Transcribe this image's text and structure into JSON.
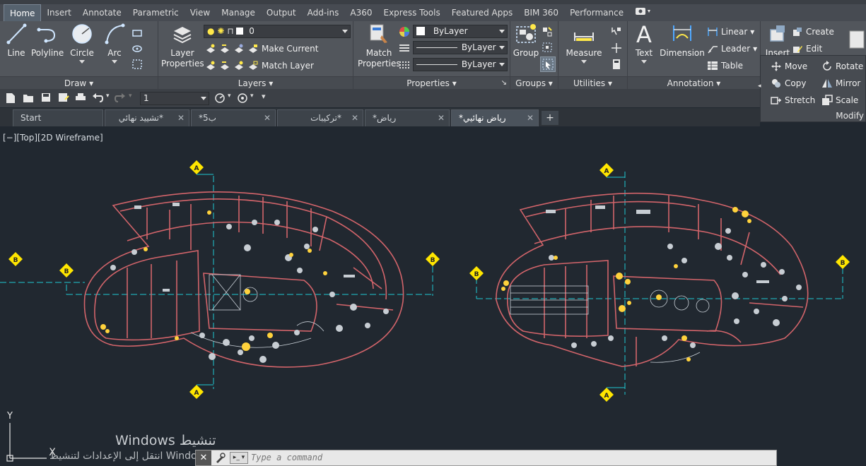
{
  "ribbon_tabs": [
    {
      "label": "Home",
      "active": true
    },
    {
      "label": "Insert"
    },
    {
      "label": "Annotate"
    },
    {
      "label": "Parametric"
    },
    {
      "label": "View"
    },
    {
      "label": "Manage"
    },
    {
      "label": "Output"
    },
    {
      "label": "Add-ins"
    },
    {
      "label": "A360"
    },
    {
      "label": "Express Tools"
    },
    {
      "label": "Featured Apps"
    },
    {
      "label": "BIM 360"
    },
    {
      "label": "Performance"
    }
  ],
  "draw": {
    "title": "Draw",
    "line": "Line",
    "polyline": "Polyline",
    "circle": "Circle",
    "arc": "Arc"
  },
  "layers": {
    "title": "Layers",
    "layer_properties_1": "Layer",
    "layer_properties_2": "Properties",
    "current_layer": "0",
    "make_current": "Make Current",
    "match_layer": "Match Layer"
  },
  "properties": {
    "title": "Properties",
    "match_1": "Match",
    "match_2": "Properties",
    "color": "ByLayer",
    "linetype": "ByLayer",
    "lineweight": "ByLayer"
  },
  "groups": {
    "title": "Groups",
    "group": "Group"
  },
  "utilities": {
    "title": "Utilities",
    "measure": "Measure"
  },
  "annotation": {
    "title": "Annotation",
    "text": "Text",
    "dimension": "Dimension",
    "linear": "Linear",
    "leader": "Leader",
    "table": "Table"
  },
  "block": {
    "insert": "Insert",
    "create": "Create",
    "edit": "Edit"
  },
  "modify": {
    "title": "Modify",
    "move": "Move",
    "rotate": "Rotate",
    "copy": "Copy",
    "mirror": "Mirror",
    "stretch": "Stretch",
    "scale": "Scale"
  },
  "qat": {
    "layer_value": "1"
  },
  "doc_tabs": [
    {
      "label": "Start"
    },
    {
      "label": "*تشييد نهائي"
    },
    {
      "label": "*ب5"
    },
    {
      "label": "*تركيبات للرياض"
    },
    {
      "label": "*رياض"
    },
    {
      "label": "*رياض نهائيي",
      "active": true
    }
  ],
  "viewport": {
    "label": "[−][Top][2D Wireframe]",
    "grid_marker": "A",
    "grid_marker_b": "B",
    "ucs_y": "Y",
    "ucs_x": "X"
  },
  "command": {
    "placeholder": "Type a command"
  },
  "watermark": {
    "line1": "Windows تنشيط",
    "line2": "انتقل إلى الإعدادات لتنشيط Windows"
  },
  "colors": {
    "ribbon_bg": "#52565c",
    "canvas_bg": "#212830",
    "wall_red": "#d2646a",
    "grid_cyan": "#1ec8d2",
    "marker_yellow": "#ffe600"
  }
}
